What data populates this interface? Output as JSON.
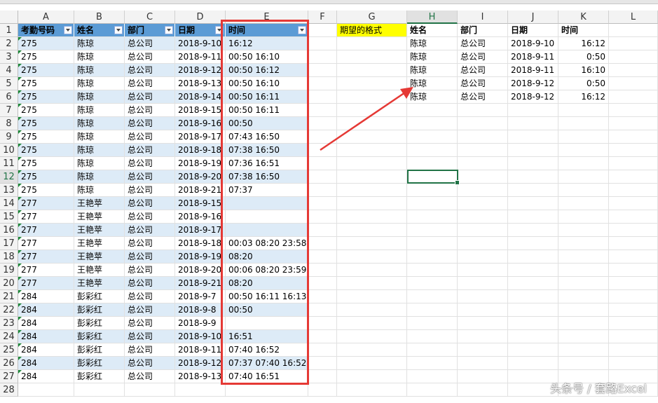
{
  "columns": [
    "A",
    "B",
    "C",
    "D",
    "E",
    "F",
    "G",
    "H",
    "I",
    "J",
    "K",
    "L"
  ],
  "row_numbers": [
    "1",
    "2",
    "3",
    "4",
    "5",
    "6",
    "7",
    "8",
    "9",
    "10",
    "11",
    "12",
    "13",
    "14",
    "15",
    "16",
    "17",
    "18",
    "19",
    "20",
    "21",
    "22",
    "23",
    "24",
    "25",
    "26",
    "27",
    "28"
  ],
  "table": {
    "headers": [
      "考勤号码",
      "姓名",
      "部门",
      "日期",
      "时间"
    ],
    "rows": [
      [
        "275",
        "陈琼",
        "总公司",
        "2018-9-10",
        "16:12"
      ],
      [
        "275",
        "陈琼",
        "总公司",
        "2018-9-11",
        "00:50 16:10"
      ],
      [
        "275",
        "陈琼",
        "总公司",
        "2018-9-12",
        "00:50 16:12"
      ],
      [
        "275",
        "陈琼",
        "总公司",
        "2018-9-13",
        "00:50 16:10"
      ],
      [
        "275",
        "陈琼",
        "总公司",
        "2018-9-14",
        "00:50 16:11"
      ],
      [
        "275",
        "陈琼",
        "总公司",
        "2018-9-15",
        "00:50 16:11"
      ],
      [
        "275",
        "陈琼",
        "总公司",
        "2018-9-16",
        "00:50"
      ],
      [
        "275",
        "陈琼",
        "总公司",
        "2018-9-17",
        "07:43 16:50"
      ],
      [
        "275",
        "陈琼",
        "总公司",
        "2018-9-18",
        "07:38 16:50"
      ],
      [
        "275",
        "陈琼",
        "总公司",
        "2018-9-19",
        "07:36 16:51"
      ],
      [
        "275",
        "陈琼",
        "总公司",
        "2018-9-20",
        "07:38 16:50"
      ],
      [
        "275",
        "陈琼",
        "总公司",
        "2018-9-21",
        "07:37"
      ],
      [
        "277",
        "王艳苹",
        "总公司",
        "2018-9-15",
        ""
      ],
      [
        "277",
        "王艳苹",
        "总公司",
        "2018-9-16",
        ""
      ],
      [
        "277",
        "王艳苹",
        "总公司",
        "2018-9-17",
        ""
      ],
      [
        "277",
        "王艳苹",
        "总公司",
        "2018-9-18",
        "00:03 08:20 23:58"
      ],
      [
        "277",
        "王艳苹",
        "总公司",
        "2018-9-19",
        "08:20"
      ],
      [
        "277",
        "王艳苹",
        "总公司",
        "2018-9-20",
        "00:06 08:20 23:59"
      ],
      [
        "277",
        "王艳苹",
        "总公司",
        "2018-9-21",
        "08:20"
      ],
      [
        "284",
        "彭彩红",
        "总公司",
        "2018-9-7",
        "00:50 16:11 16:13"
      ],
      [
        "284",
        "彭彩红",
        "总公司",
        "2018-9-8",
        "00:50"
      ],
      [
        "284",
        "彭彩红",
        "总公司",
        "2018-9-9",
        ""
      ],
      [
        "284",
        "彭彩红",
        "总公司",
        "2018-9-10",
        "16:51"
      ],
      [
        "284",
        "彭彩红",
        "总公司",
        "2018-9-11",
        "07:40 16:52"
      ],
      [
        "284",
        "彭彩红",
        "总公司",
        "2018-9-12",
        "07:37 07:40 16:52"
      ],
      [
        "284",
        "彭彩红",
        "总公司",
        "2018-9-13",
        "07:40 16:51"
      ]
    ]
  },
  "desired_label": "期望的格式",
  "desired": {
    "headers": [
      "姓名",
      "部门",
      "日期",
      "时间"
    ],
    "rows": [
      [
        "陈琼",
        "总公司",
        "2018-9-10",
        "16:12"
      ],
      [
        "陈琼",
        "总公司",
        "2018-9-11",
        "0:50"
      ],
      [
        "陈琼",
        "总公司",
        "2018-9-11",
        "16:10"
      ],
      [
        "陈琼",
        "总公司",
        "2018-9-12",
        "0:50"
      ],
      [
        "陈琼",
        "总公司",
        "2018-9-12",
        "16:12"
      ]
    ]
  },
  "selected_cell": "H12",
  "watermark": "头条号 / 套路Excel",
  "colors": {
    "header_fill": "#5b9bd5",
    "band_fill": "#ddebf7",
    "highlight_box": "#e53935",
    "label_fill": "#ffff00",
    "selection": "#217346"
  }
}
